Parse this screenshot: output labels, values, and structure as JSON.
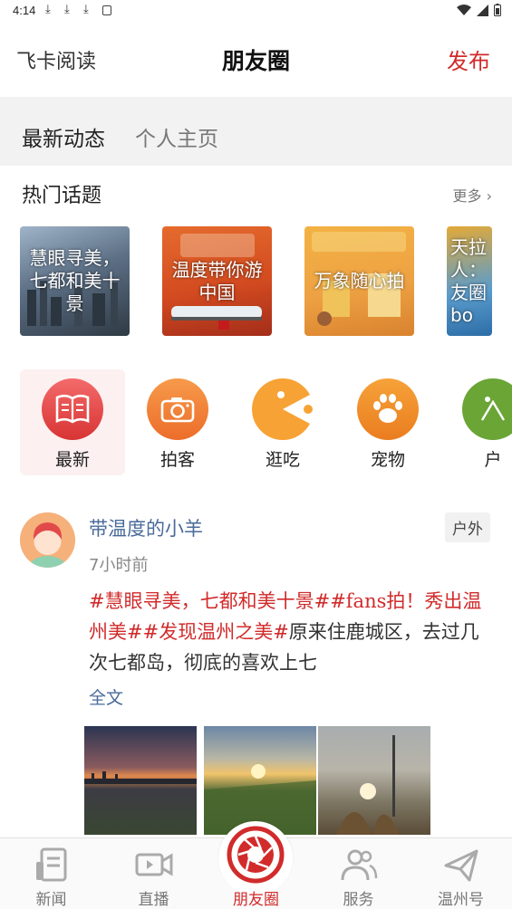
{
  "status": {
    "time": "4:14"
  },
  "header": {
    "left": "飞卡阅读",
    "title": "朋友圈",
    "right": "发布"
  },
  "tabs": [
    {
      "label": "最新动态"
    },
    {
      "label": "个人主页"
    }
  ],
  "hot_topics": {
    "title": "热门话题",
    "more": "更多",
    "items": [
      {
        "label": "慧眼寻美，七都和美十景"
      },
      {
        "label": "温度带你游中国"
      },
      {
        "label": "万象随心拍"
      },
      {
        "label": "天拉人：友圈bo"
      }
    ]
  },
  "categories": [
    {
      "label": "最新",
      "icon": "book-icon"
    },
    {
      "label": "拍客",
      "icon": "camera-icon"
    },
    {
      "label": "逛吃",
      "icon": "pacman-icon"
    },
    {
      "label": "宠物",
      "icon": "paw-icon"
    },
    {
      "label": "户",
      "icon": "outdoor-icon"
    }
  ],
  "post": {
    "user": "带温度的小羊",
    "tag": "户外",
    "time": "7小时前",
    "hashtags": "#慧眼寻美，七都和美十景##fans拍！秀出温州美##发现温州之美#",
    "text": "原来住鹿城区，去过几次七都岛，彻底的喜欢上七",
    "more": "全文"
  },
  "tabbar": [
    {
      "label": "新闻"
    },
    {
      "label": "直播"
    },
    {
      "label": "朋友圈"
    },
    {
      "label": "服务"
    },
    {
      "label": "温州号"
    }
  ],
  "colors": {
    "accent": "#d12b2b",
    "link": "#4a6a9a",
    "tab_bg": "#f2f2f2"
  }
}
